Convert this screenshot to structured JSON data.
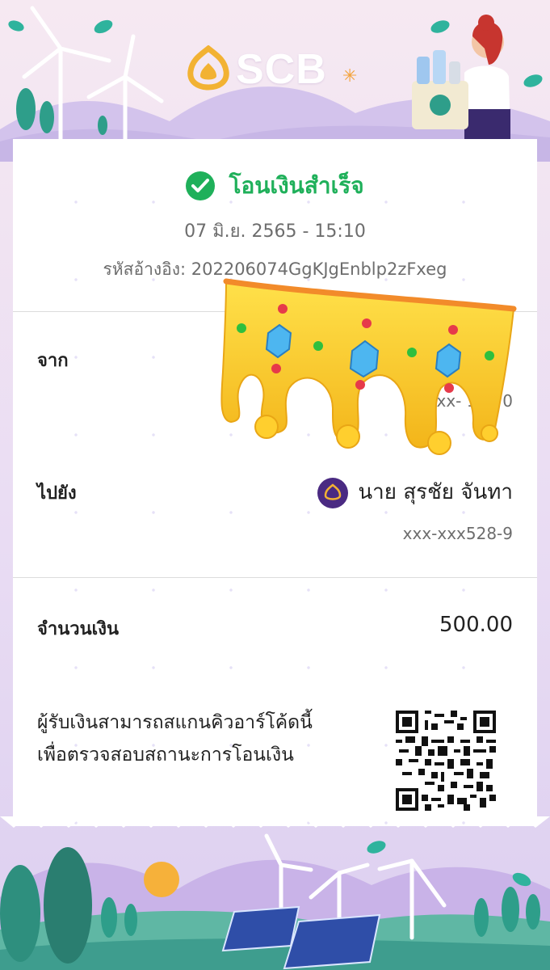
{
  "brand": {
    "name": "SCB",
    "accent": "#4a2a82",
    "success_color": "#1fb05a"
  },
  "status": {
    "text": "โอนเงินสำเร็จ",
    "icon": "check-circle-icon"
  },
  "datetime": "07 มิ.ย. 2565 - 15:10",
  "reference": "รหัสอ้างอิง: 202206074GgKJgEnblp2zFxeg",
  "from": {
    "label": "จาก",
    "account_number": "xxx-    184 0"
  },
  "to": {
    "label": "ไปยัง",
    "name": "นาย สุรชัย จันทา",
    "account_number": "xxx-xxx528-9"
  },
  "amount": {
    "label": "จำนวนเงิน",
    "value": "500.00"
  },
  "qr_note": {
    "line1": "ผู้รับเงินสามารถสแกนคิวอาร์โค้ดนี้",
    "line2": "เพื่อตรวจสอบสถานะการโอนเงิน"
  }
}
